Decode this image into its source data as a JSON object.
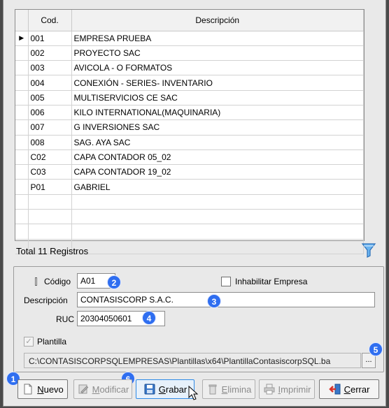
{
  "grid": {
    "columns": [
      "Cod.",
      "Descripción"
    ],
    "rows": [
      {
        "cod": "001",
        "desc": "EMPRESA PRUEBA"
      },
      {
        "cod": "002",
        "desc": "PROYECTO SAC"
      },
      {
        "cod": "003",
        "desc": "AVICOLA - O FORMATOS"
      },
      {
        "cod": "004",
        "desc": "CONEXIÓN - SERIES- INVENTARIO"
      },
      {
        "cod": "005",
        "desc": "MULTISERVICIOS CE  SAC"
      },
      {
        "cod": "006",
        "desc": "KILO INTERNATIONAL(MAQUINARIA)"
      },
      {
        "cod": "007",
        "desc": "G INVERSIONES SAC"
      },
      {
        "cod": "008",
        "desc": "SAG. AYA SAC"
      },
      {
        "cod": "C02",
        "desc": "CAPA CONTADOR 05_02"
      },
      {
        "cod": "C03",
        "desc": "CAPA CONTADOR 19_02"
      },
      {
        "cod": "P01",
        "desc": "GABRIEL"
      }
    ],
    "empty_rows": 4,
    "selected_row_indicator": "▶"
  },
  "total_label": "Total 11 Registros",
  "form": {
    "codigo_label": "Código",
    "codigo_value": "A01",
    "inhabilitar_label": "Inhabilitar Empresa",
    "inhabilitar_checked": false,
    "descripcion_label": "Descripción",
    "descripcion_value": "CONTASISCORP S.A.C.",
    "ruc_label": "RUC",
    "ruc_value": "20304050601",
    "plantilla_label": "Plantilla",
    "plantilla_checked": true,
    "plantilla_path": "C:\\CONTASISCORPSQLEMPRESAS\\Plantillas\\x64\\PlantillaContasiscorpSQL.ba",
    "browse_label": "..."
  },
  "badges": [
    "1",
    "2",
    "3",
    "4",
    "5",
    "6"
  ],
  "toolbar": {
    "nuevo": "Nuevo",
    "modificar": "Modificar",
    "grabar": "Grabar",
    "elimina": "Elimina",
    "imprimir": "Imprimir",
    "cerrar": "Cerrar"
  },
  "colors": {
    "badge": "#2f6ef0",
    "focus_border": "#2e8ae6",
    "cerrar_icon": "#d9342b"
  }
}
